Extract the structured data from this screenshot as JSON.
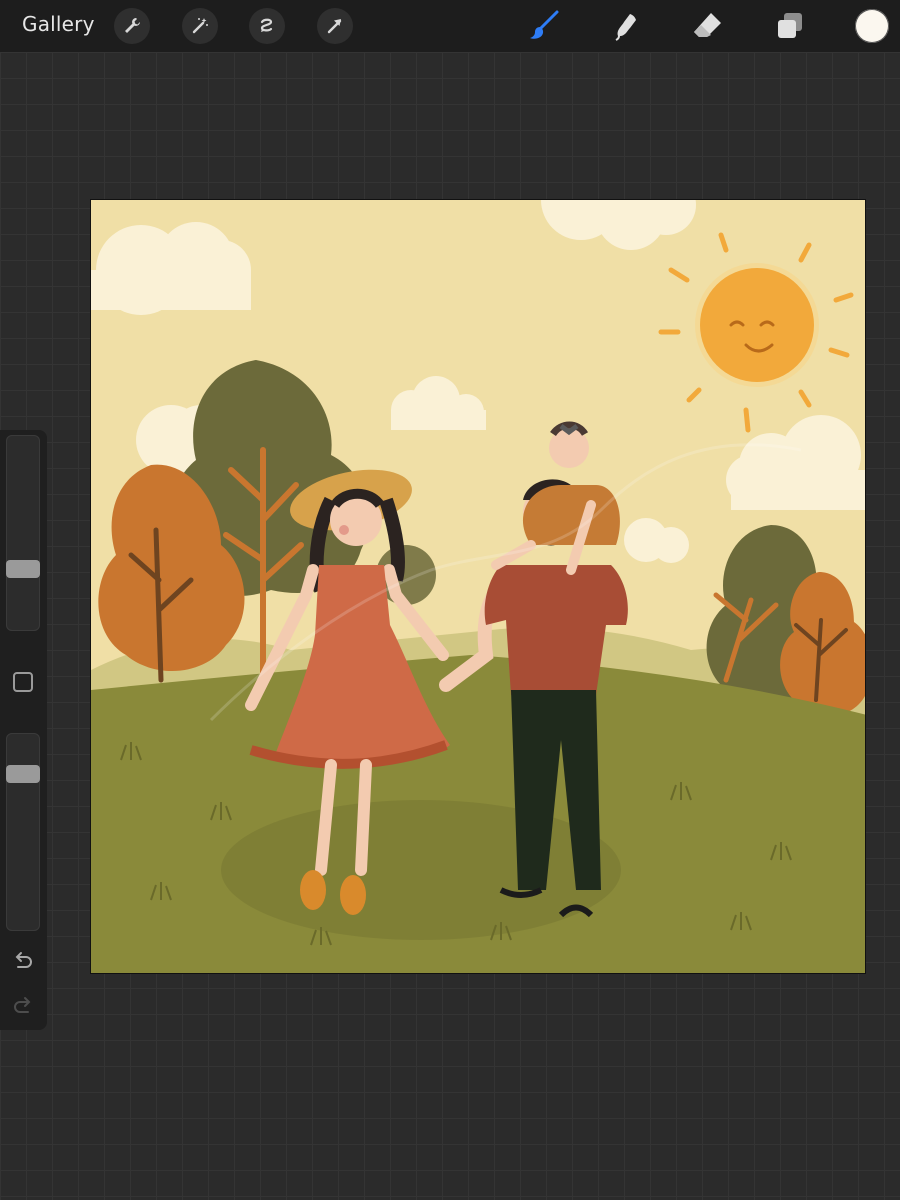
{
  "toolbar": {
    "gallery_label": "Gallery",
    "left_tools": [
      "wrench-icon",
      "magic-wand-icon",
      "selection-icon",
      "transform-arrow-icon"
    ],
    "right_tools": [
      "brush-icon",
      "smudge-icon",
      "eraser-icon",
      "layers-icon"
    ],
    "active_tool": "brush-icon",
    "current_color": "#fbf7ef"
  },
  "sidebar": {
    "brush_size_level": 0.3,
    "opacity_level": 0.82
  },
  "colors": {
    "accent": "#2e7df6",
    "sky": "#f0dfa6",
    "grass": "#8a8a3a",
    "sun": "#f2a93b"
  }
}
